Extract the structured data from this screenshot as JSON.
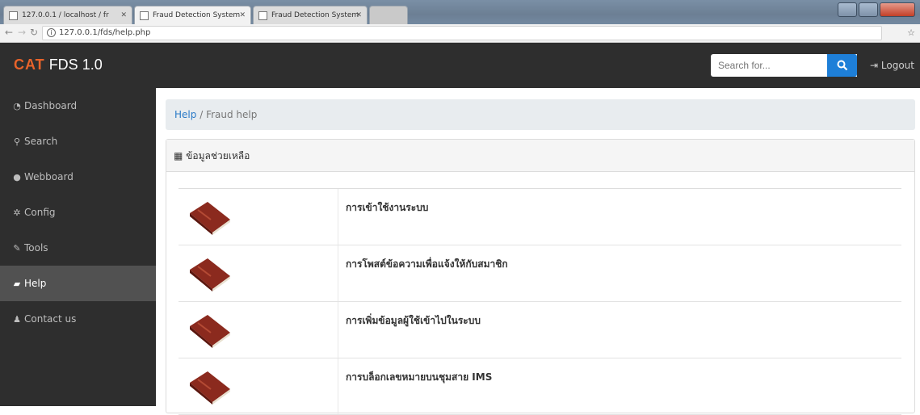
{
  "browser": {
    "tabs": [
      {
        "label": "127.0.0.1 / localhost / fr"
      },
      {
        "label": "Fraud Detection System"
      },
      {
        "label": "Fraud Detection System"
      }
    ],
    "url": "127.0.0.1/fds/help.php"
  },
  "navbar": {
    "brand_logo": "CAT",
    "brand_name": "FDS 1.0",
    "search_placeholder": "Search for...",
    "logout_label": "Logout"
  },
  "sidebar": {
    "items": [
      {
        "label": "Dashboard",
        "icon": "dashboard-icon"
      },
      {
        "label": "Search",
        "icon": "search-icon"
      },
      {
        "label": "Webboard",
        "icon": "comment-icon"
      },
      {
        "label": "Config",
        "icon": "gear-icon"
      },
      {
        "label": "Tools",
        "icon": "wrench-icon"
      },
      {
        "label": "Help",
        "icon": "book-icon",
        "active": true
      },
      {
        "label": "Contact us",
        "icon": "user-icon"
      }
    ]
  },
  "breadcrumb": {
    "root": "Help",
    "separator": "/",
    "current": "Fraud help"
  },
  "panel": {
    "title": "ข้อมูลช่วยเหลือ",
    "items": [
      {
        "label": "การเข้าใช้งานระบบ"
      },
      {
        "label": "การโพสต์ข้อความเพื่อแจ้งให้กับสมาชิก"
      },
      {
        "label": "การเพิ่มข้อมูลผู้ใช้เข้าไปในระบบ"
      },
      {
        "label": "การบล็อกเลขหมายบนชุมสาย IMS"
      }
    ]
  },
  "colors": {
    "navbar_bg": "#2e2e2e",
    "brand_accent": "#e8632a",
    "search_button": "#1e7fd8",
    "link": "#2a7ac7"
  }
}
